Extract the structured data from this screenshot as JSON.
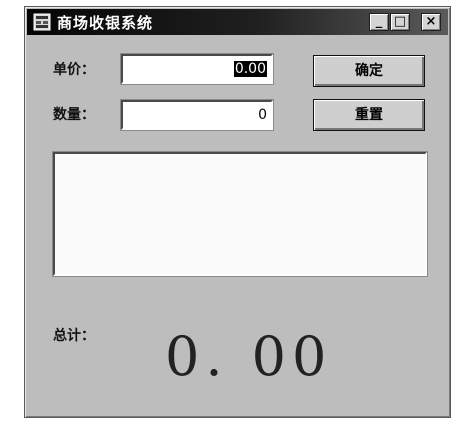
{
  "window": {
    "title": "商场收银系统",
    "controls": {
      "minimize": "_",
      "maximize": "□",
      "close": "×"
    }
  },
  "form": {
    "price_label": "单价：",
    "price_value": "0.00",
    "quantity_label": "数量：",
    "quantity_value": "0"
  },
  "buttons": {
    "confirm": "确定",
    "reset": "重置"
  },
  "list": {
    "items": []
  },
  "total": {
    "label": "总计：",
    "value": "0. 00"
  },
  "colors": {
    "window_bg": "#bdbdbd",
    "titlebar": "#050505",
    "field_bg": "#ffffff"
  },
  "icons": {
    "app": "app-icon"
  }
}
